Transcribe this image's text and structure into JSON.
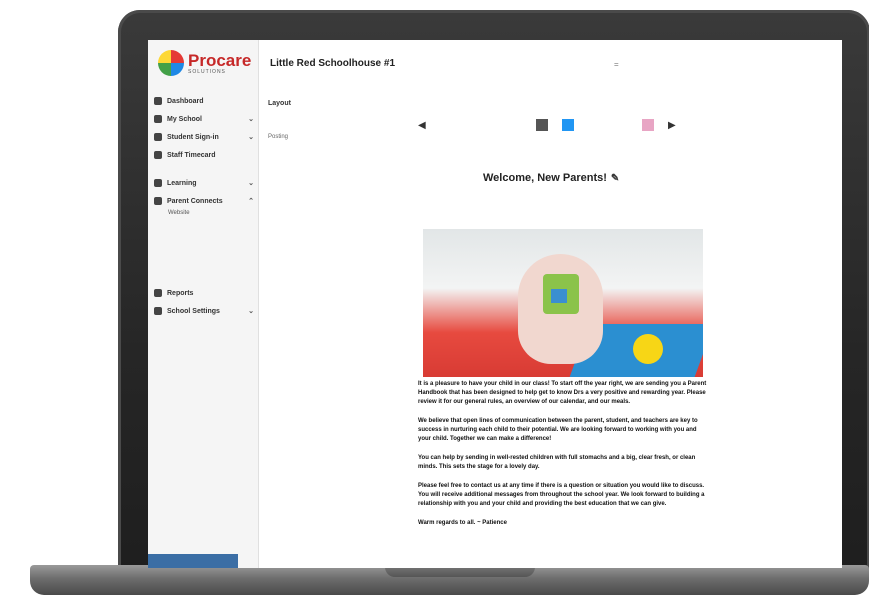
{
  "header": {
    "school_name": "Little Red Schoolhouse #1",
    "top_mark": "="
  },
  "logo": {
    "name": "Procare",
    "tagline": "SOLUTIONS"
  },
  "sidebar": {
    "items": [
      {
        "label": "Dashboard",
        "icon": "dashboard-icon"
      },
      {
        "label": "My School",
        "icon": "school-icon",
        "chevron": "⌄"
      },
      {
        "label": "Student Sign-in",
        "icon": "sign-in-icon",
        "chevron": "⌄"
      },
      {
        "label": "Staff Timecard",
        "icon": "timecard-icon"
      },
      {
        "label": "Learning",
        "icon": "learning-icon",
        "chevron": "⌄"
      },
      {
        "label": "Parent Connects",
        "icon": "parents-icon",
        "chevron": "⌃"
      },
      {
        "label": "Reports",
        "icon": "reports-icon"
      },
      {
        "label": "School Settings",
        "icon": "settings-icon",
        "chevron": "⌄"
      }
    ],
    "sub_item": "Website"
  },
  "middle": {
    "layout_label": "Layout",
    "posting_label": "Posting"
  },
  "content": {
    "welcome_title": "Welcome, New Parents!",
    "paragraphs": [
      "It is a pleasure to have your child in our class! To start off the year right, we are sending you a Parent Handbook that has been designed to help get to know Drs a very positive and rewarding year. Please review it for our general rules, an overview of our calendar, and our meals.",
      "We believe that open lines of communication between the parent, student, and teachers are key to success in nurturing each child to their potential. We are looking forward to working with you and your child. Together we can make a difference!",
      "You can help by sending in well-rested children with full stomachs and a big, clear fresh, or clean minds. This sets the stage for a lovely day.",
      "Please feel free to contact us at any time if there is a question or situation you would like to discuss. You will receive additional messages from throughout the school year. We look forward to building a relationship with you and your child and providing the best education that we can give.",
      "Warm regards to all. ~ Patience"
    ]
  },
  "colors": {
    "brand": "#c62828",
    "swatches": [
      "#555555",
      "#2196f3",
      "#e8a5c4"
    ]
  }
}
